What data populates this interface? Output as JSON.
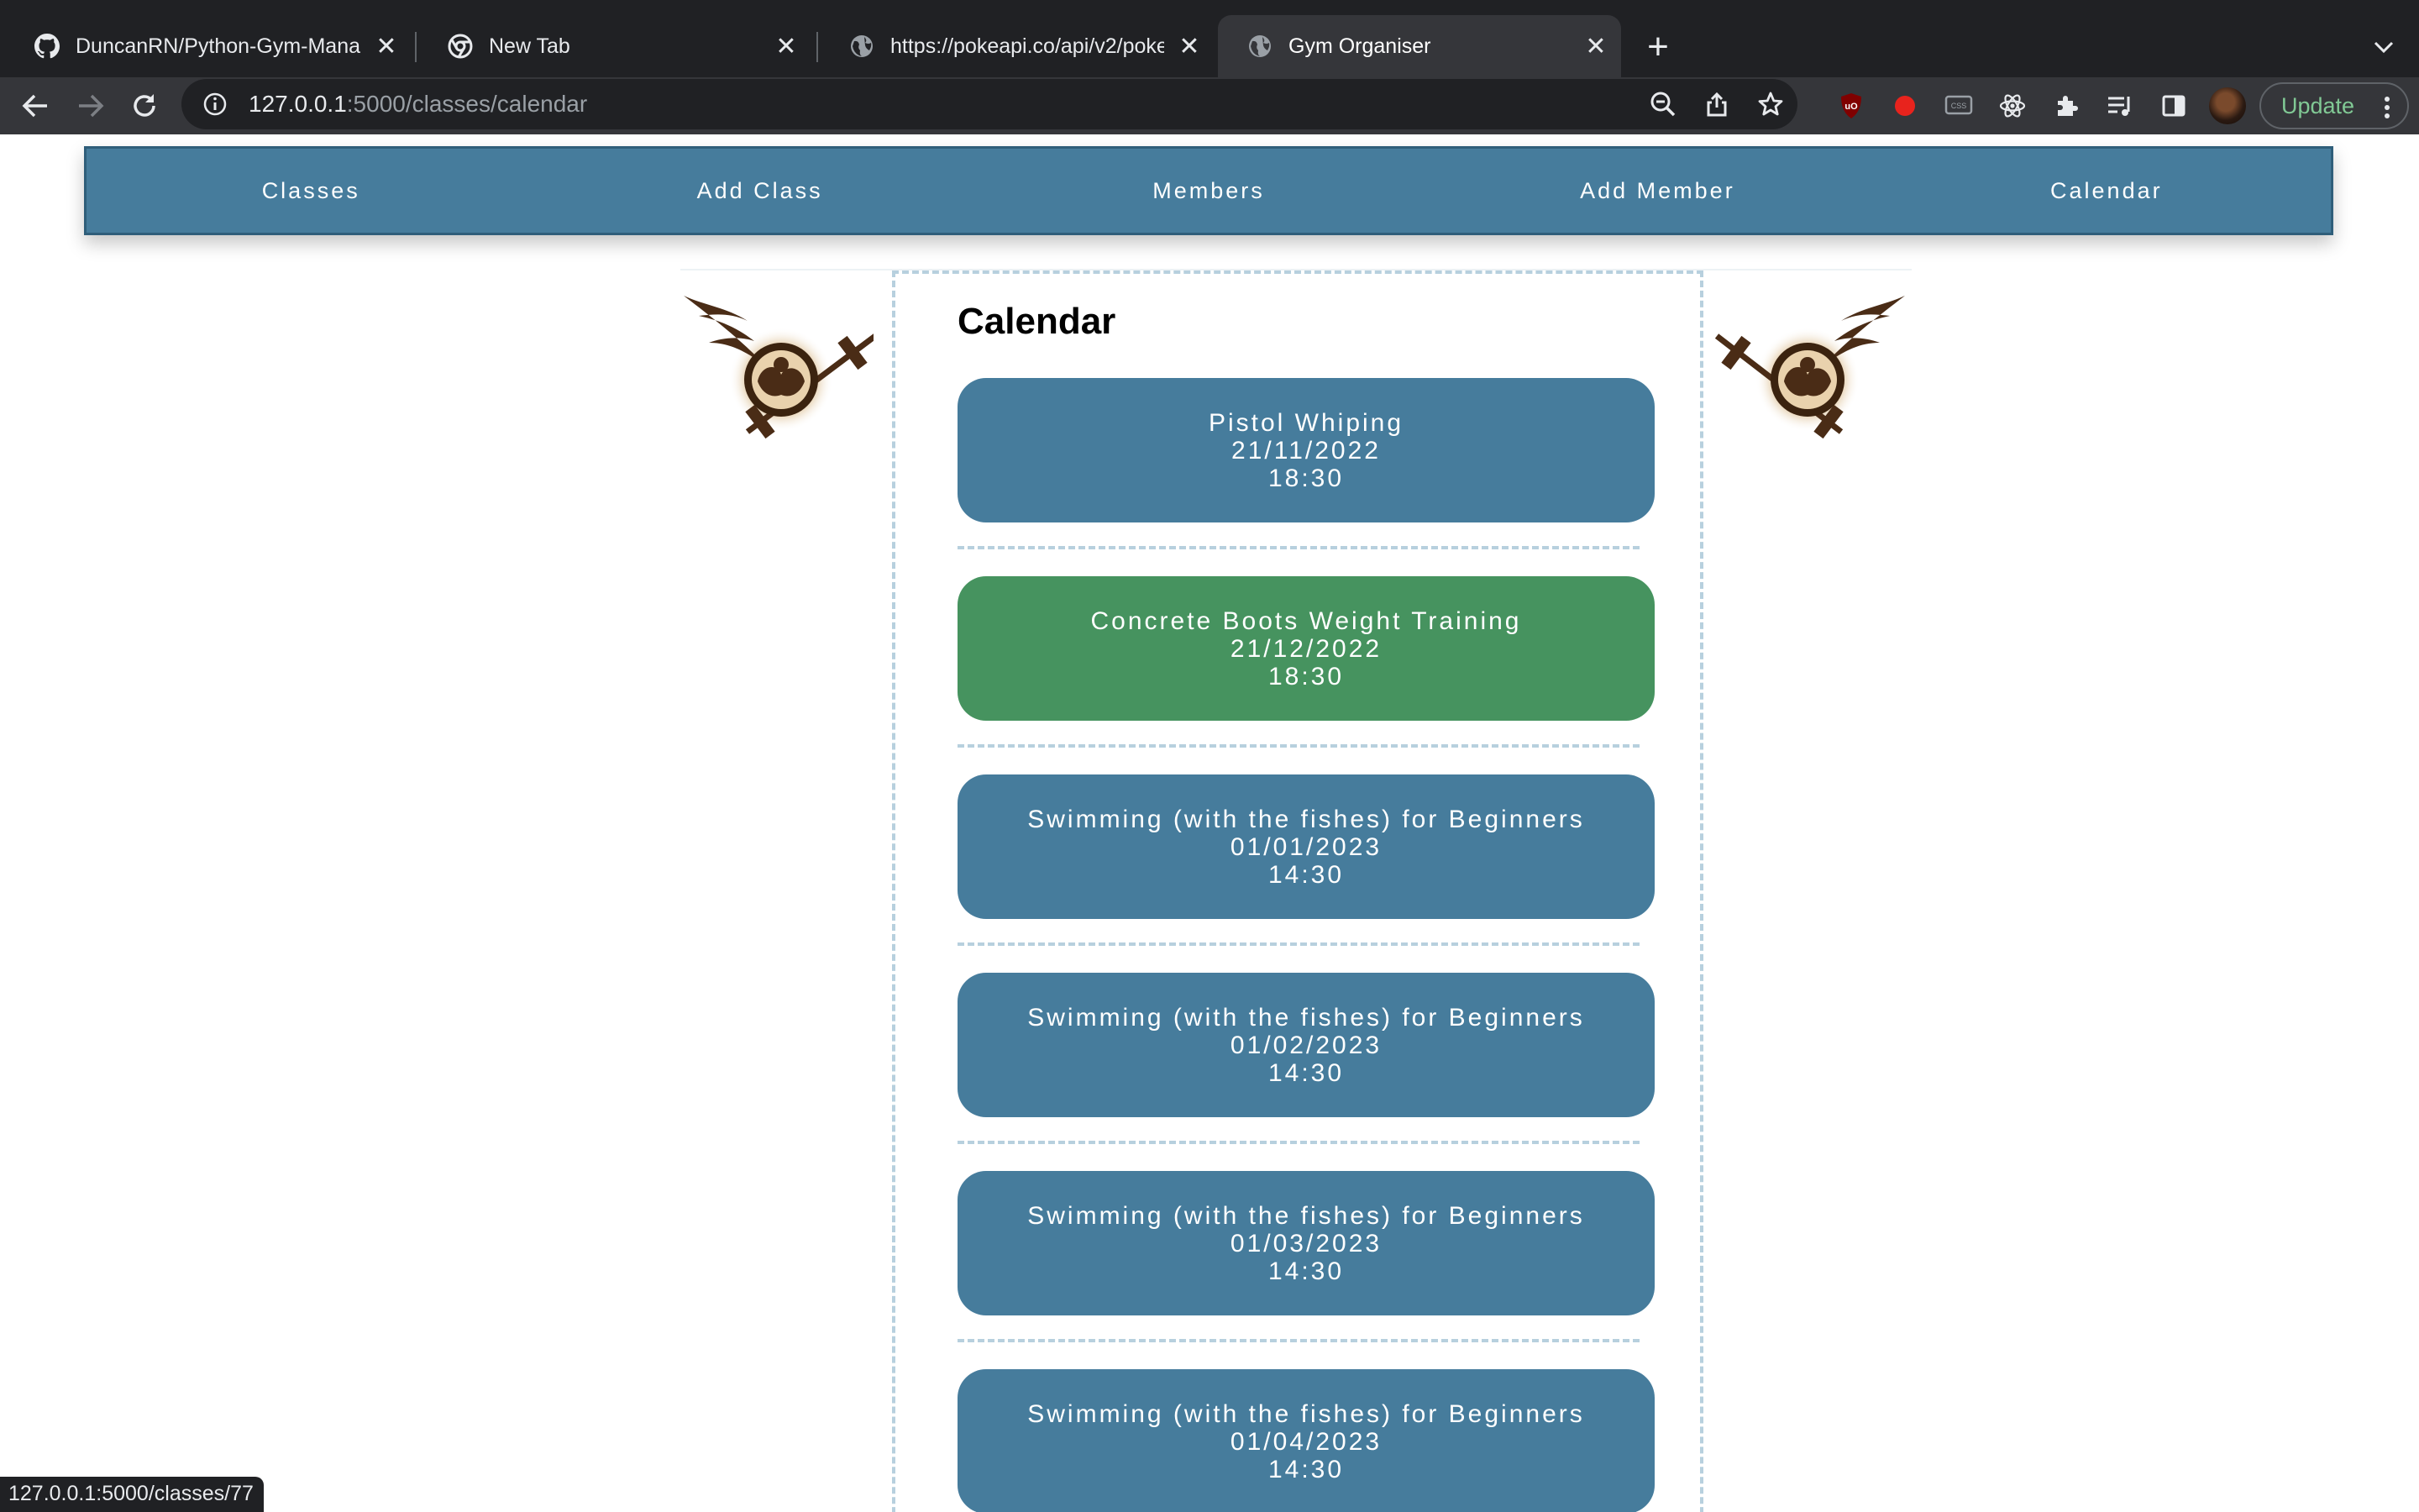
{
  "browser": {
    "tabs": [
      {
        "title": "DuncanRN/Python-Gym-Manag",
        "icon": "github-icon",
        "active": false
      },
      {
        "title": "New Tab",
        "icon": "chrome-icon",
        "active": false
      },
      {
        "title": "https://pokeapi.co/api/v2/poke",
        "icon": "globe-icon",
        "active": false
      },
      {
        "title": "Gym Organiser",
        "icon": "globe-icon",
        "active": true
      }
    ],
    "url_host": "127.0.0.1",
    "url_path": ":5000/classes/calendar",
    "update_label": "Update",
    "status_url": "127.0.0.1:5000/classes/77"
  },
  "site_nav": {
    "classes": "Classes",
    "add_class": "Add Class",
    "members": "Members",
    "add_member": "Add Member",
    "calendar": "Calendar"
  },
  "page": {
    "title": "Calendar"
  },
  "classes": [
    {
      "name": "Pistol Whiping",
      "date": "21/11/2022",
      "time": "18:30",
      "color": "#467c9c"
    },
    {
      "name": "Concrete Boots Weight Training",
      "date": "21/12/2022",
      "time": "18:30",
      "color": "#46935f"
    },
    {
      "name": "Swimming (with the fishes) for Beginners",
      "date": "01/01/2023",
      "time": "14:30",
      "color": "#467c9c"
    },
    {
      "name": "Swimming (with the fishes) for Beginners",
      "date": "01/02/2023",
      "time": "14:30",
      "color": "#467c9c"
    },
    {
      "name": "Swimming (with the fishes) for Beginners",
      "date": "01/03/2023",
      "time": "14:30",
      "color": "#467c9c"
    },
    {
      "name": "Swimming (with the fishes) for Beginners",
      "date": "01/04/2023",
      "time": "14:30",
      "color": "#467c9c"
    }
  ]
}
